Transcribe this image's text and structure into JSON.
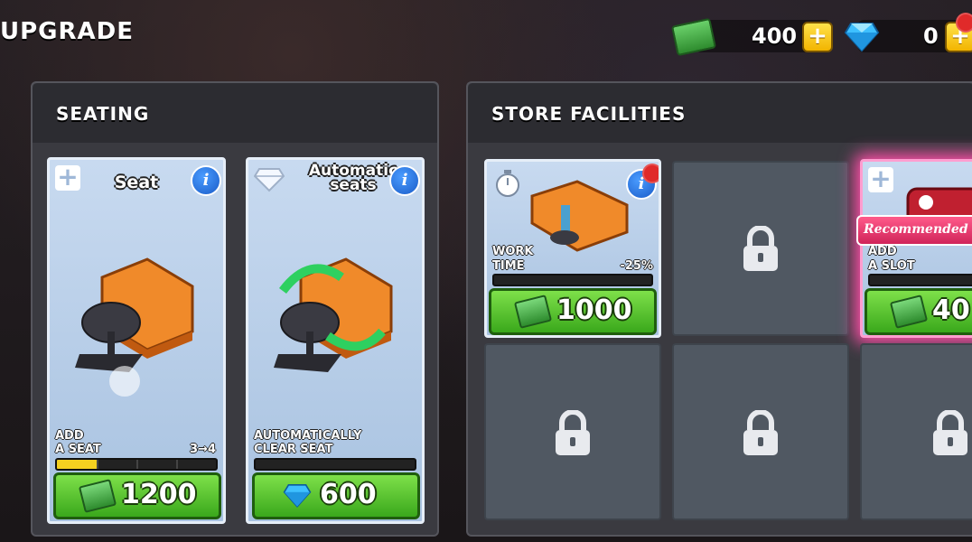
{
  "header": {
    "title": "UPGRADE"
  },
  "currency": {
    "cash": "400",
    "gems": "0",
    "plus": "+"
  },
  "seating": {
    "title": "SEATING",
    "cards": [
      {
        "name": "Seat",
        "desc_line1": "ADD",
        "desc_line2": "A SEAT",
        "level": "3→4",
        "progress": 0.25,
        "price": "1200",
        "price_currency": "cash"
      },
      {
        "name_line1": "Automatic",
        "name_line2": "seats",
        "desc_line1": "AUTOMATICALLY",
        "desc_line2": "CLEAR SEAT",
        "progress": 0,
        "price": "600",
        "price_currency": "gems"
      }
    ]
  },
  "facilities": {
    "title": "STORE FACILITIES",
    "cards": [
      {
        "desc_line1": "WORK",
        "desc_line2": "TIME",
        "effect": "-25%",
        "price": "1000",
        "price_currency": "cash"
      },
      {
        "badge": "Recommended",
        "desc_line1": "ADD",
        "desc_line2": "A SLOT",
        "price": "40",
        "price_currency": "cash"
      }
    ]
  },
  "colors": {
    "accent_green": "#3aa81c",
    "panel": "#3a3a40",
    "badge_pink": "#d0245a"
  }
}
